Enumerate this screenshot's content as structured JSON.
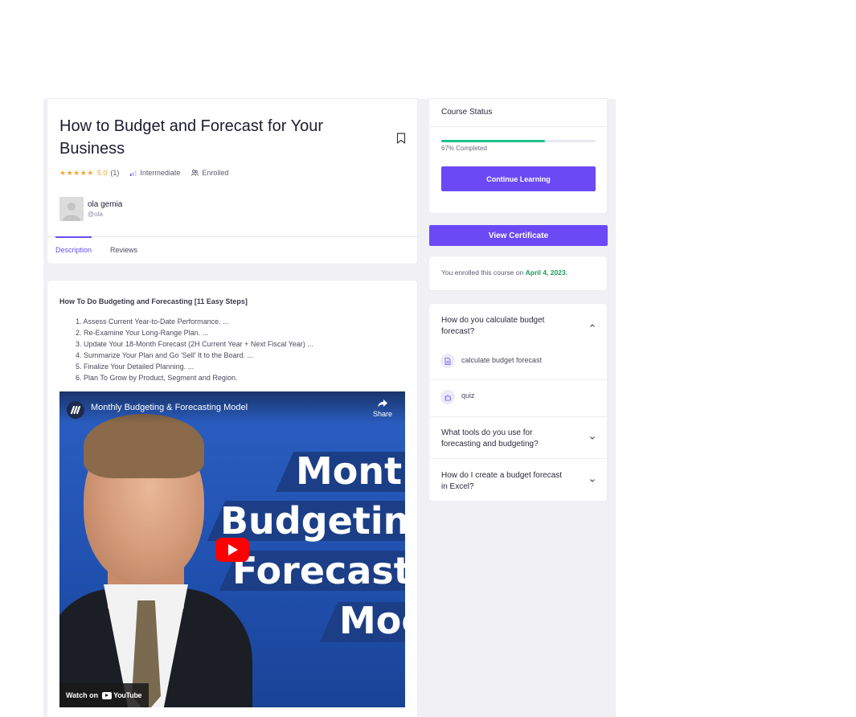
{
  "course": {
    "title": "How to Budget and Forecast for Your Business",
    "rating_stars": "★★★★★",
    "rating_value": "5.0",
    "rating_count": "(1)",
    "level": "Intermediate",
    "enrollment": "Enrolled"
  },
  "instructor": {
    "name": "ola gemia",
    "handle": "@ola"
  },
  "tabs": {
    "description": "Description",
    "reviews": "Reviews"
  },
  "description": {
    "heading": "How To Do Budgeting and Forecasting [11 Easy Steps]",
    "steps": [
      "1. Assess Current Year-to-Date Performance. ...",
      "2. Re-Examine Your Long-Range Plan. ...",
      "3. Update Your 18-Month Forecast (2H Current Year + Next Fiscal Year) ...",
      "4. Summarize Your Plan and Go 'Sell' It to the Board. ...",
      "5. Finalize Your Detailed Planning. ...",
      "6. Plan To Grow by Product, Segment and Region."
    ]
  },
  "video": {
    "title": "Monthly Budgeting & Forecasting Model",
    "share_label": "Share",
    "watch_on": "Watch on",
    "youtube_label": "YouTube",
    "thumb_line1": "Montl",
    "thumb_line2": "Budgeting",
    "thumb_line3": "Forecasti",
    "thumb_line4": "Moc"
  },
  "status": {
    "title": "Course Status",
    "progress_fraction": 0.67,
    "progress_text": "67% Completed",
    "continue_label": "Continue Learning",
    "certificate_label": "View Certificate",
    "enrolled_prefix": "You enrolled this course on",
    "enrolled_date": "April 4, 2023."
  },
  "curriculum": {
    "topics": [
      "How do you calculate budget forecast?",
      "What tools do you use for forecasting and budgeting?",
      "How do I create a budget forecast in Excel?"
    ],
    "lessons": [
      {
        "label": "calculate budget forecast",
        "icon": "document-icon"
      },
      {
        "label": "quiz",
        "icon": "puzzle-icon"
      }
    ]
  },
  "colors": {
    "accent": "#6b4af5",
    "progress": "#1cc08a",
    "date": "#1c9a5a",
    "stars": "#f3a33a"
  }
}
